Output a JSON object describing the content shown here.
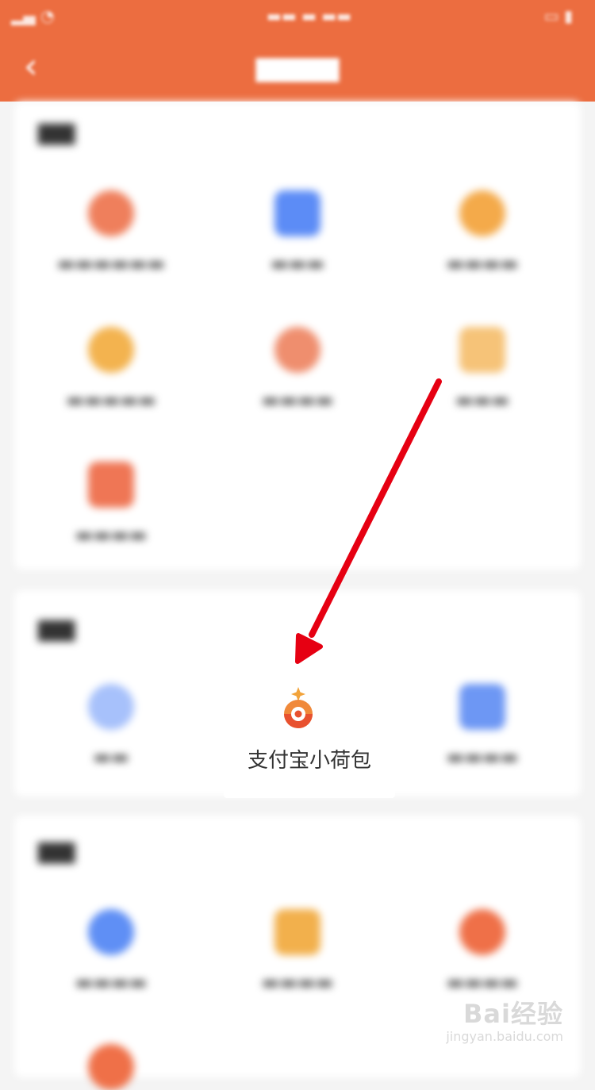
{
  "header": {
    "back_icon": "chevron-left-icon",
    "bg_color": "#ec6d40"
  },
  "focus_item": {
    "label": "支付宝小荷包",
    "icon": "alipay-xiaohebao-icon"
  },
  "annotation": {
    "arrow_color": "#e60012"
  },
  "watermark": {
    "brand": "Bai经验",
    "url": "jingyan.baidu.com"
  }
}
